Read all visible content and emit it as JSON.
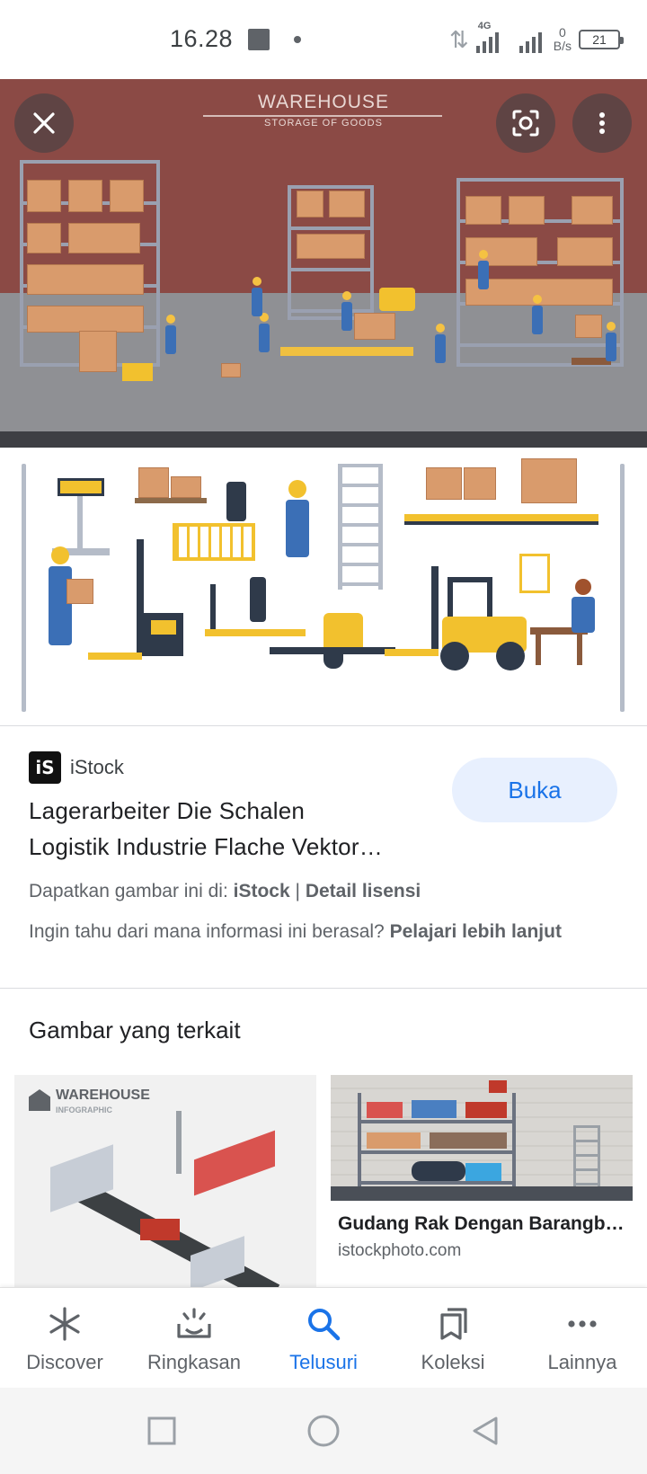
{
  "status_bar": {
    "time": "16.28",
    "network_type": "4G",
    "speed_value": "0",
    "speed_unit": "B/s",
    "battery": "21"
  },
  "hero_image": {
    "title": "WAREHOUSE",
    "subtitle": "STORAGE OF GOODS",
    "close_icon": "close-icon",
    "lens_icon": "google-lens-icon",
    "menu_icon": "more-vert-icon"
  },
  "result": {
    "source_logo": "iS",
    "source_name": "iStock",
    "open_label": "Buka",
    "title_line1": "Lagerarbeiter Die Schalen",
    "title_line2": "Logistik Industrie Flache Vektor…",
    "license_prefix": "Dapatkan gambar ini di:",
    "license_source": "iStock",
    "license_separator": "|",
    "license_link": "Detail lisensi",
    "info_question": "Ingin tahu dari mana informasi ini berasal?",
    "info_link": "Pelajari lebih lanjut"
  },
  "related": {
    "heading": "Gambar yang terkait",
    "items": [
      {
        "image_text_1": "WAREHOUSE",
        "image_text_2": "INFOGRAPHIC"
      },
      {
        "title": "Gudang Rak Dengan Barangb…",
        "domain": "istockphoto.com"
      }
    ]
  },
  "bottom_nav": {
    "items": [
      {
        "label": "Discover",
        "icon": "asterisk-icon"
      },
      {
        "label": "Ringkasan",
        "icon": "updates-icon"
      },
      {
        "label": "Telusuri",
        "icon": "search-icon"
      },
      {
        "label": "Koleksi",
        "icon": "bookmarks-icon"
      },
      {
        "label": "Lainnya",
        "icon": "more-horiz-icon"
      }
    ],
    "active_index": 2
  },
  "colors": {
    "accent": "#1a73e8",
    "accent_bg": "#e8f0fe",
    "hero_wall": "#8b4a45"
  }
}
